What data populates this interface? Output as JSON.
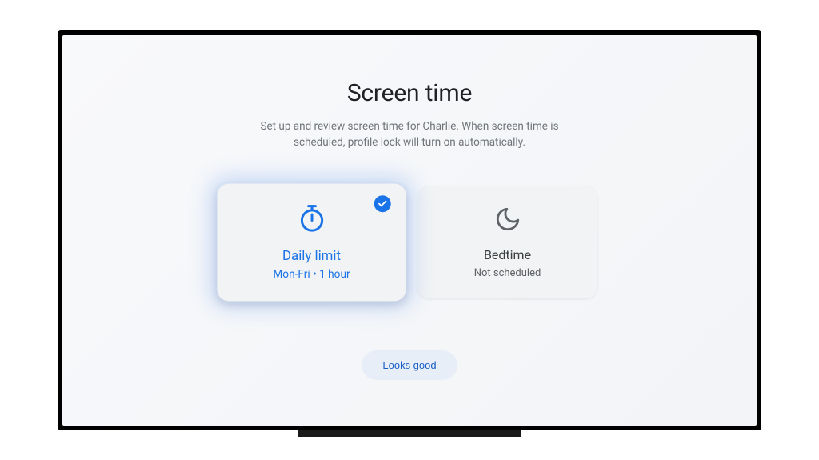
{
  "header": {
    "title": "Screen time",
    "description": "Set up and review screen time for Charlie. When screen time is scheduled, profile lock will turn on automatically."
  },
  "cards": {
    "daily_limit": {
      "title": "Daily limit",
      "subtitle": "Mon-Fri • 1 hour",
      "checked": true,
      "focused": true
    },
    "bedtime": {
      "title": "Bedtime",
      "subtitle": "Not scheduled",
      "checked": false,
      "focused": false
    }
  },
  "actions": {
    "primary_label": "Looks good"
  },
  "colors": {
    "accent": "#1a73e8",
    "text_primary": "#202124",
    "text_secondary": "#70757a"
  }
}
